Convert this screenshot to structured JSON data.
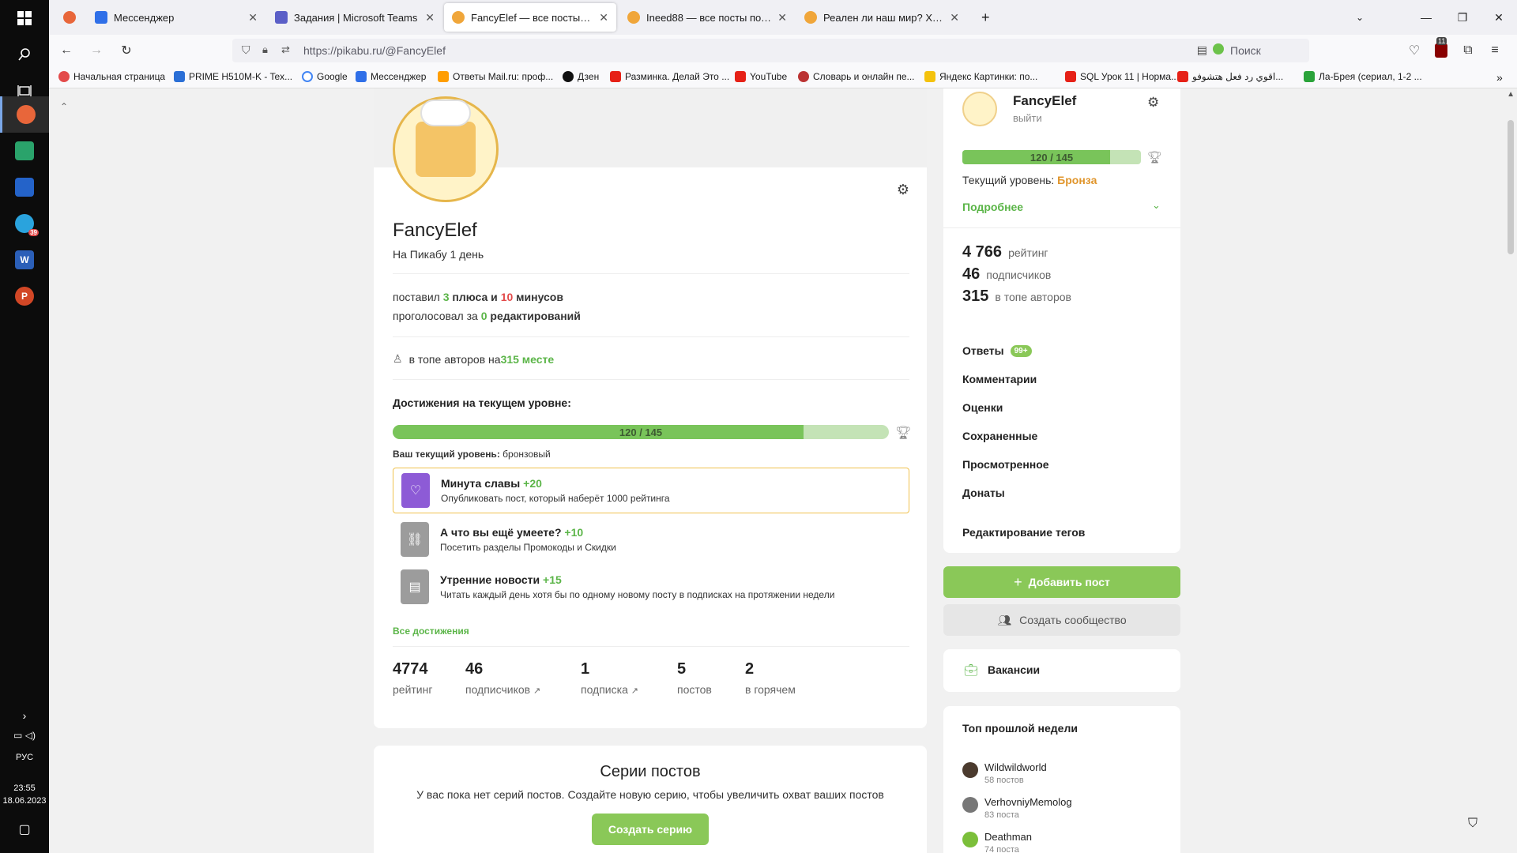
{
  "taskbar": {
    "lang": "РУС",
    "time": "23:55",
    "date": "18.06.2023",
    "telegram_badge": "39"
  },
  "tabs": [
    {
      "title": "Мессенджер",
      "color": "#2f6fe8"
    },
    {
      "title": "Задания | Microsoft Teams",
      "color": "#5b5fc7"
    },
    {
      "title": "FancyElef — все посты пользо...",
      "color": "#f0a63a"
    },
    {
      "title": "Ineed88 — все посты пользова...",
      "color": "#f0a63a"
    },
    {
      "title": "Реален ли наш мир? Хороше...",
      "color": "#f0a63a"
    }
  ],
  "navbar": {
    "url": "https://pikabu.ru/@FancyElef",
    "search_placeholder": "Поиск",
    "ext_badge": "11"
  },
  "bookmarks": [
    "Начальная страница",
    "PRIME H510M-K - Tex...",
    "Google",
    "Мессенджер",
    "Ответы Mail.ru: проф...",
    "Дзен",
    "Разминка. Делай Это ...",
    "YouTube",
    "Словарь и онлайн пе...",
    "Яндекс Картинки: по...",
    "SQL Урок 11 | Норма...",
    "اقوي رد فعل هتشوفو...",
    "Ла-Брея (сериал, 1-2 ..."
  ],
  "profile": {
    "username": "FancyElef",
    "since": "На Пикабу 1 день",
    "votes_line": {
      "pre": "поставил ",
      "plus": "3",
      "mid1": " плюса",
      "and": " и ",
      "minus": "10",
      "mid2": " минусов"
    },
    "edits_line": {
      "pre": "проголосовал за ",
      "num": "0",
      "post": " редактирований"
    },
    "rank_line": {
      "pre": "в топе авторов на ",
      "rank": "315 месте"
    },
    "achievements_title": "Достижения на текущем уровне:",
    "progress_text": "120 / 145",
    "progress_value": 0.8276,
    "level_label": "Ваш текущий уровень:",
    "level_value": "бронзовый",
    "achievements": [
      {
        "title": "Минута славы",
        "points": "+20",
        "desc": "Опубликовать пост, который наберёт 1000 рейтинга",
        "color": "#8d5bd6",
        "icon": "heart-icon"
      },
      {
        "title": "А что вы ещё умеете?",
        "points": "+10",
        "desc": "Посетить разделы Промокоды и Скидки",
        "color": "#9c9c9c",
        "icon": "link-icon"
      },
      {
        "title": "Утренние новости",
        "points": "+15",
        "desc": "Читать каждый день хотя бы по одному новому посту в подписках на протяжении недели",
        "color": "#9c9c9c",
        "icon": "newspaper-icon"
      }
    ],
    "all_achievements": "Все достижения",
    "stats": [
      {
        "num": "4774",
        "label": "рейтинг"
      },
      {
        "num": "46",
        "label": "подписчиков"
      },
      {
        "num": "1",
        "label": "подписка"
      },
      {
        "num": "5",
        "label": "постов"
      },
      {
        "num": "2",
        "label": "в горячем"
      }
    ]
  },
  "series": {
    "title": "Серии постов",
    "desc": "У вас пока нет серий постов. Создайте новую серию, чтобы увеличить охват ваших постов",
    "button": "Создать серию"
  },
  "sidebar": {
    "username": "FancyElef",
    "logout": "выйти",
    "progress_text": "120 / 145",
    "progress_value": 0.8276,
    "level_label": "Текущий уровень: ",
    "level_value": "Бронза",
    "details": "Подробнее",
    "rating_num": "4 766",
    "rating_label": "рейтинг",
    "subs_num": "46",
    "subs_label": "подписчиков",
    "top_num": "315",
    "top_label": "в топе авторов",
    "menu": {
      "answers": "Ответы",
      "answers_badge": "99+",
      "comments": "Комментарии",
      "ratings": "Оценки",
      "saved": "Сохраненные",
      "viewed": "Просмотренное",
      "donates": "Донаты",
      "tags": "Редактирование тегов"
    },
    "add_post": "Добавить пост",
    "create_community": "Создать сообщество",
    "vacancies": "Вакансии",
    "top_week_title": "Топ прошлой недели",
    "top_users": [
      {
        "name": "Wildwildworld",
        "sub": "58 постов",
        "color": "#4b3b2e"
      },
      {
        "name": "VerhovniyMemolog",
        "sub": "83 поста",
        "color": "#777777"
      },
      {
        "name": "Deathman",
        "sub": "74 поста",
        "color": "#7bbf3a"
      }
    ]
  }
}
